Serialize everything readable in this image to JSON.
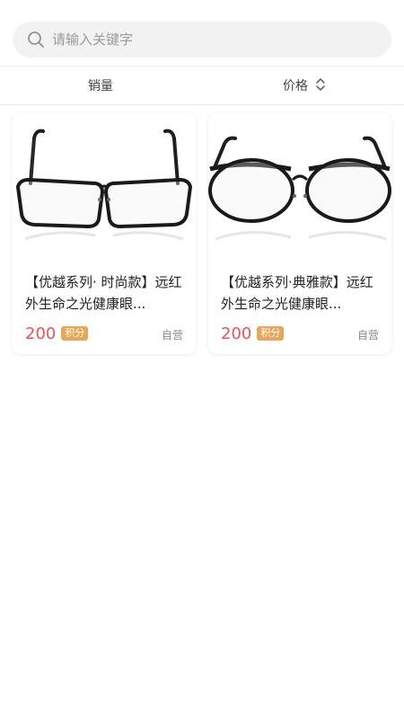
{
  "search": {
    "placeholder": "请输入关键字",
    "icon": "search-icon"
  },
  "sort": {
    "sales_label": "销量",
    "price_label": "价格",
    "price_icon": "sort-arrows-icon"
  },
  "products": [
    {
      "title": "【优越系列· 时尚款】远红外生命之光健康眼...",
      "points": "200",
      "points_unit": "积分",
      "tag": "自营",
      "image": "rectangular-glasses"
    },
    {
      "title": "【优越系列·典雅款】远红外生命之光健康眼...",
      "points": "200",
      "points_unit": "积分",
      "tag": "自营",
      "image": "round-glasses"
    }
  ],
  "colors": {
    "points": "#e0555a",
    "badge": "#e7a65a",
    "search_bg": "#f2f2f2"
  }
}
